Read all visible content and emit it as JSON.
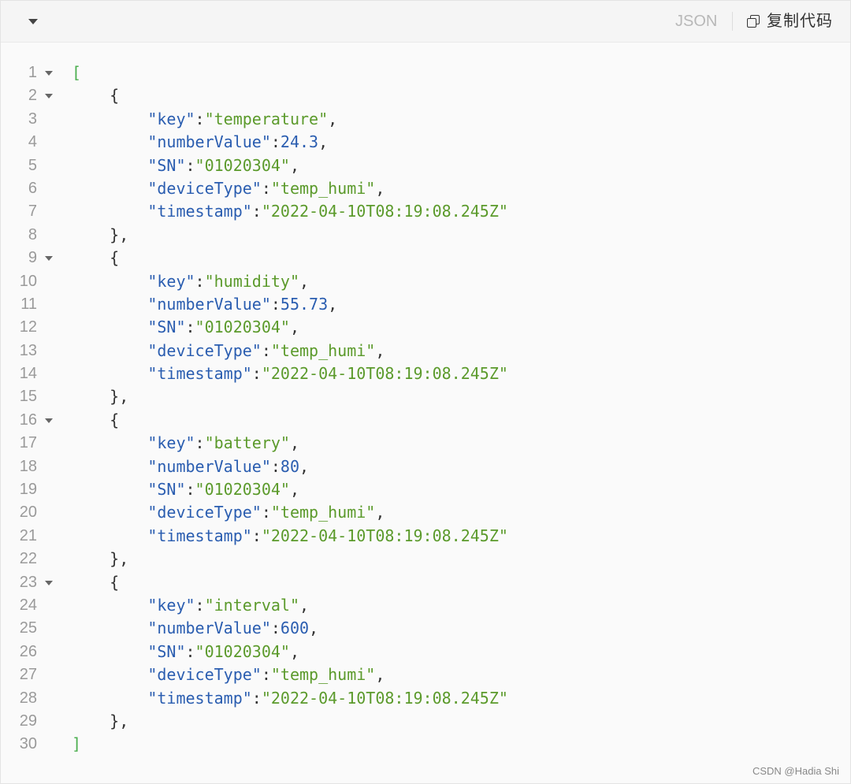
{
  "toolbar": {
    "language": "JSON",
    "copy_label": "复制代码",
    "collapse_icon": "caret-down-icon",
    "copy_icon": "copy-icon"
  },
  "code": {
    "lines": [
      {
        "n": "1",
        "fold": true,
        "tokens": [
          [
            "bracket",
            "["
          ]
        ]
      },
      {
        "n": "2",
        "fold": true,
        "tokens": [
          [
            "punct",
            "    {"
          ]
        ]
      },
      {
        "n": "3",
        "fold": false,
        "tokens": [
          [
            "punct",
            "        "
          ],
          [
            "key",
            "\"key\""
          ],
          [
            "punct",
            ":"
          ],
          [
            "str",
            "\"temperature\""
          ],
          [
            "punct",
            ","
          ]
        ]
      },
      {
        "n": "4",
        "fold": false,
        "tokens": [
          [
            "punct",
            "        "
          ],
          [
            "key",
            "\"numberValue\""
          ],
          [
            "punct",
            ":"
          ],
          [
            "num",
            "24.3"
          ],
          [
            "punct",
            ","
          ]
        ]
      },
      {
        "n": "5",
        "fold": false,
        "tokens": [
          [
            "punct",
            "        "
          ],
          [
            "key",
            "\"SN\""
          ],
          [
            "punct",
            ":"
          ],
          [
            "str",
            "\"01020304\""
          ],
          [
            "punct",
            ","
          ]
        ]
      },
      {
        "n": "6",
        "fold": false,
        "tokens": [
          [
            "punct",
            "        "
          ],
          [
            "key",
            "\"deviceType\""
          ],
          [
            "punct",
            ":"
          ],
          [
            "str",
            "\"temp_humi\""
          ],
          [
            "punct",
            ","
          ]
        ]
      },
      {
        "n": "7",
        "fold": false,
        "tokens": [
          [
            "punct",
            "        "
          ],
          [
            "key",
            "\"timestamp\""
          ],
          [
            "punct",
            ":"
          ],
          [
            "str",
            "\"2022-04-10T08:19:08.245Z\""
          ]
        ]
      },
      {
        "n": "8",
        "fold": false,
        "tokens": [
          [
            "punct",
            "    },"
          ]
        ]
      },
      {
        "n": "9",
        "fold": true,
        "tokens": [
          [
            "punct",
            "    {"
          ]
        ]
      },
      {
        "n": "10",
        "fold": false,
        "tokens": [
          [
            "punct",
            "        "
          ],
          [
            "key",
            "\"key\""
          ],
          [
            "punct",
            ":"
          ],
          [
            "str",
            "\"humidity\""
          ],
          [
            "punct",
            ","
          ]
        ]
      },
      {
        "n": "11",
        "fold": false,
        "tokens": [
          [
            "punct",
            "        "
          ],
          [
            "key",
            "\"numberValue\""
          ],
          [
            "punct",
            ":"
          ],
          [
            "num",
            "55.73"
          ],
          [
            "punct",
            ","
          ]
        ]
      },
      {
        "n": "12",
        "fold": false,
        "tokens": [
          [
            "punct",
            "        "
          ],
          [
            "key",
            "\"SN\""
          ],
          [
            "punct",
            ":"
          ],
          [
            "str",
            "\"01020304\""
          ],
          [
            "punct",
            ","
          ]
        ]
      },
      {
        "n": "13",
        "fold": false,
        "tokens": [
          [
            "punct",
            "        "
          ],
          [
            "key",
            "\"deviceType\""
          ],
          [
            "punct",
            ":"
          ],
          [
            "str",
            "\"temp_humi\""
          ],
          [
            "punct",
            ","
          ]
        ]
      },
      {
        "n": "14",
        "fold": false,
        "tokens": [
          [
            "punct",
            "        "
          ],
          [
            "key",
            "\"timestamp\""
          ],
          [
            "punct",
            ":"
          ],
          [
            "str",
            "\"2022-04-10T08:19:08.245Z\""
          ]
        ]
      },
      {
        "n": "15",
        "fold": false,
        "tokens": [
          [
            "punct",
            "    },"
          ]
        ]
      },
      {
        "n": "16",
        "fold": true,
        "tokens": [
          [
            "punct",
            "    {"
          ]
        ]
      },
      {
        "n": "17",
        "fold": false,
        "tokens": [
          [
            "punct",
            "        "
          ],
          [
            "key",
            "\"key\""
          ],
          [
            "punct",
            ":"
          ],
          [
            "str",
            "\"battery\""
          ],
          [
            "punct",
            ","
          ]
        ]
      },
      {
        "n": "18",
        "fold": false,
        "tokens": [
          [
            "punct",
            "        "
          ],
          [
            "key",
            "\"numberValue\""
          ],
          [
            "punct",
            ":"
          ],
          [
            "num",
            "80"
          ],
          [
            "punct",
            ","
          ]
        ]
      },
      {
        "n": "19",
        "fold": false,
        "tokens": [
          [
            "punct",
            "        "
          ],
          [
            "key",
            "\"SN\""
          ],
          [
            "punct",
            ":"
          ],
          [
            "str",
            "\"01020304\""
          ],
          [
            "punct",
            ","
          ]
        ]
      },
      {
        "n": "20",
        "fold": false,
        "tokens": [
          [
            "punct",
            "        "
          ],
          [
            "key",
            "\"deviceType\""
          ],
          [
            "punct",
            ":"
          ],
          [
            "str",
            "\"temp_humi\""
          ],
          [
            "punct",
            ","
          ]
        ]
      },
      {
        "n": "21",
        "fold": false,
        "tokens": [
          [
            "punct",
            "        "
          ],
          [
            "key",
            "\"timestamp\""
          ],
          [
            "punct",
            ":"
          ],
          [
            "str",
            "\"2022-04-10T08:19:08.245Z\""
          ]
        ]
      },
      {
        "n": "22",
        "fold": false,
        "tokens": [
          [
            "punct",
            "    },"
          ]
        ]
      },
      {
        "n": "23",
        "fold": true,
        "tokens": [
          [
            "punct",
            "    {"
          ]
        ]
      },
      {
        "n": "24",
        "fold": false,
        "tokens": [
          [
            "punct",
            "        "
          ],
          [
            "key",
            "\"key\""
          ],
          [
            "punct",
            ":"
          ],
          [
            "str",
            "\"interval\""
          ],
          [
            "punct",
            ","
          ]
        ]
      },
      {
        "n": "25",
        "fold": false,
        "tokens": [
          [
            "punct",
            "        "
          ],
          [
            "key",
            "\"numberValue\""
          ],
          [
            "punct",
            ":"
          ],
          [
            "num",
            "600"
          ],
          [
            "punct",
            ","
          ]
        ]
      },
      {
        "n": "26",
        "fold": false,
        "tokens": [
          [
            "punct",
            "        "
          ],
          [
            "key",
            "\"SN\""
          ],
          [
            "punct",
            ":"
          ],
          [
            "str",
            "\"01020304\""
          ],
          [
            "punct",
            ","
          ]
        ]
      },
      {
        "n": "27",
        "fold": false,
        "tokens": [
          [
            "punct",
            "        "
          ],
          [
            "key",
            "\"deviceType\""
          ],
          [
            "punct",
            ":"
          ],
          [
            "str",
            "\"temp_humi\""
          ],
          [
            "punct",
            ","
          ]
        ]
      },
      {
        "n": "28",
        "fold": false,
        "tokens": [
          [
            "punct",
            "        "
          ],
          [
            "key",
            "\"timestamp\""
          ],
          [
            "punct",
            ":"
          ],
          [
            "str",
            "\"2022-04-10T08:19:08.245Z\""
          ]
        ]
      },
      {
        "n": "29",
        "fold": false,
        "tokens": [
          [
            "punct",
            "    },"
          ]
        ]
      },
      {
        "n": "30",
        "fold": false,
        "tokens": [
          [
            "bracket",
            "]"
          ]
        ]
      }
    ]
  },
  "watermark": "CSDN @Hadia Shi",
  "colors": {
    "key": "#2a5db0",
    "string": "#5b9a2b",
    "number": "#2a5db0",
    "bracket": "#4caf50",
    "line_number": "#9a9a9a"
  }
}
